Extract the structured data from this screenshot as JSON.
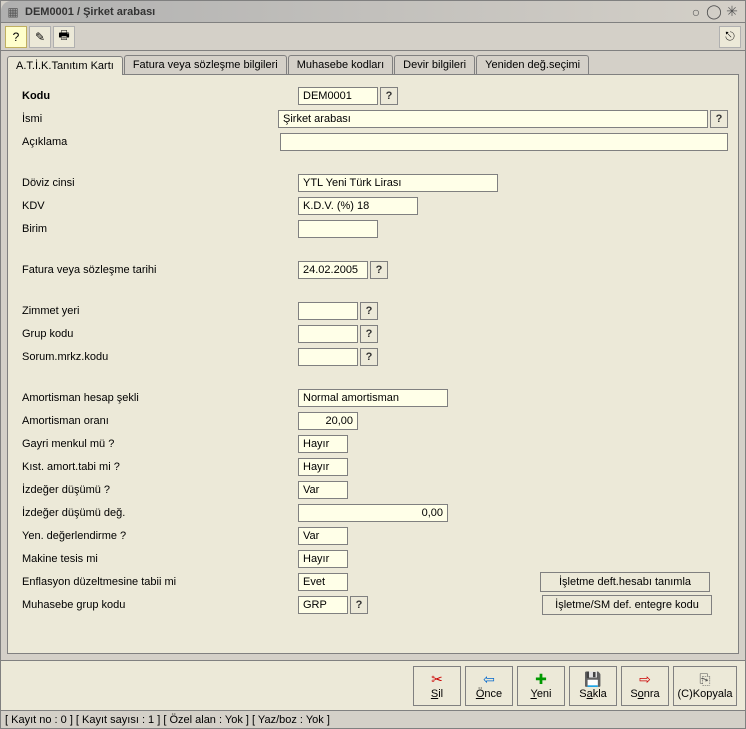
{
  "window": {
    "title": "DEM0001 / Şirket arabası"
  },
  "tabs": {
    "t1": "A.T.İ.K.Tanıtım Kartı",
    "t2": "Fatura veya sözleşme bilgileri",
    "t3": "Muhasebe kodları",
    "t4": "Devir bilgileri",
    "t5": "Yeniden değ.seçimi"
  },
  "labels": {
    "kodu": "Kodu",
    "ismi": "İsmi",
    "aciklama": "Açıklama",
    "doviz": "Döviz cinsi",
    "kdv": "KDV",
    "birim": "Birim",
    "faturaTarih": "Fatura veya sözleşme tarihi",
    "zimmet": "Zimmet yeri",
    "grup": "Grup kodu",
    "sorum": "Sorum.mrkz.kodu",
    "amortSekli": "Amortisman hesap şekli",
    "amortOrani": "Amortisman oranı",
    "gayri": "Gayri menkul mü ?",
    "kist": "Kıst. amort.tabi mi ?",
    "izdeger": "İzdeğer düşümü ?",
    "izdegerDeg": "İzdeğer düşümü değ.",
    "yenDeg": "Yen. değerlendirme ?",
    "makine": "Makine tesis mi",
    "enflasyon": "Enflasyon düzeltmesine tabii mi",
    "muhasebeGrup": "Muhasebe grup kodu"
  },
  "values": {
    "kodu": "DEM0001",
    "ismi": "Şirket arabası",
    "aciklama": "",
    "doviz": "YTL Yeni Türk Lirası",
    "kdv": "K.D.V. (%) 18",
    "birim": "",
    "faturaTarih": "24.02.2005",
    "zimmet": "",
    "grup": "",
    "sorum": "",
    "amortSekli": "Normal amortisman",
    "amortOrani": "20,00",
    "gayri": "Hayır",
    "kist": "Hayır",
    "izdeger": "Var",
    "izdegerDeg": "0,00",
    "yenDeg": "Var",
    "makine": "Hayır",
    "enflasyon": "Evet",
    "muhasebeGrup": "GRP"
  },
  "buttons": {
    "isletmeDeft": "İşletme deft.hesabı tanımla",
    "isletmeSM": "İşletme/SM def. entegre kodu"
  },
  "bottom": {
    "sil": "Sil",
    "once": "Önce",
    "yeni": "Yeni",
    "sakla": "Sakla",
    "sonra": "Sonra",
    "kopyala": "(C)Kopyala"
  },
  "status": "[ Kayıt no : 0 ] [ Kayıt sayısı : 1 ] [ Özel alan : Yok ] [ Yaz/boz : Yok ]"
}
